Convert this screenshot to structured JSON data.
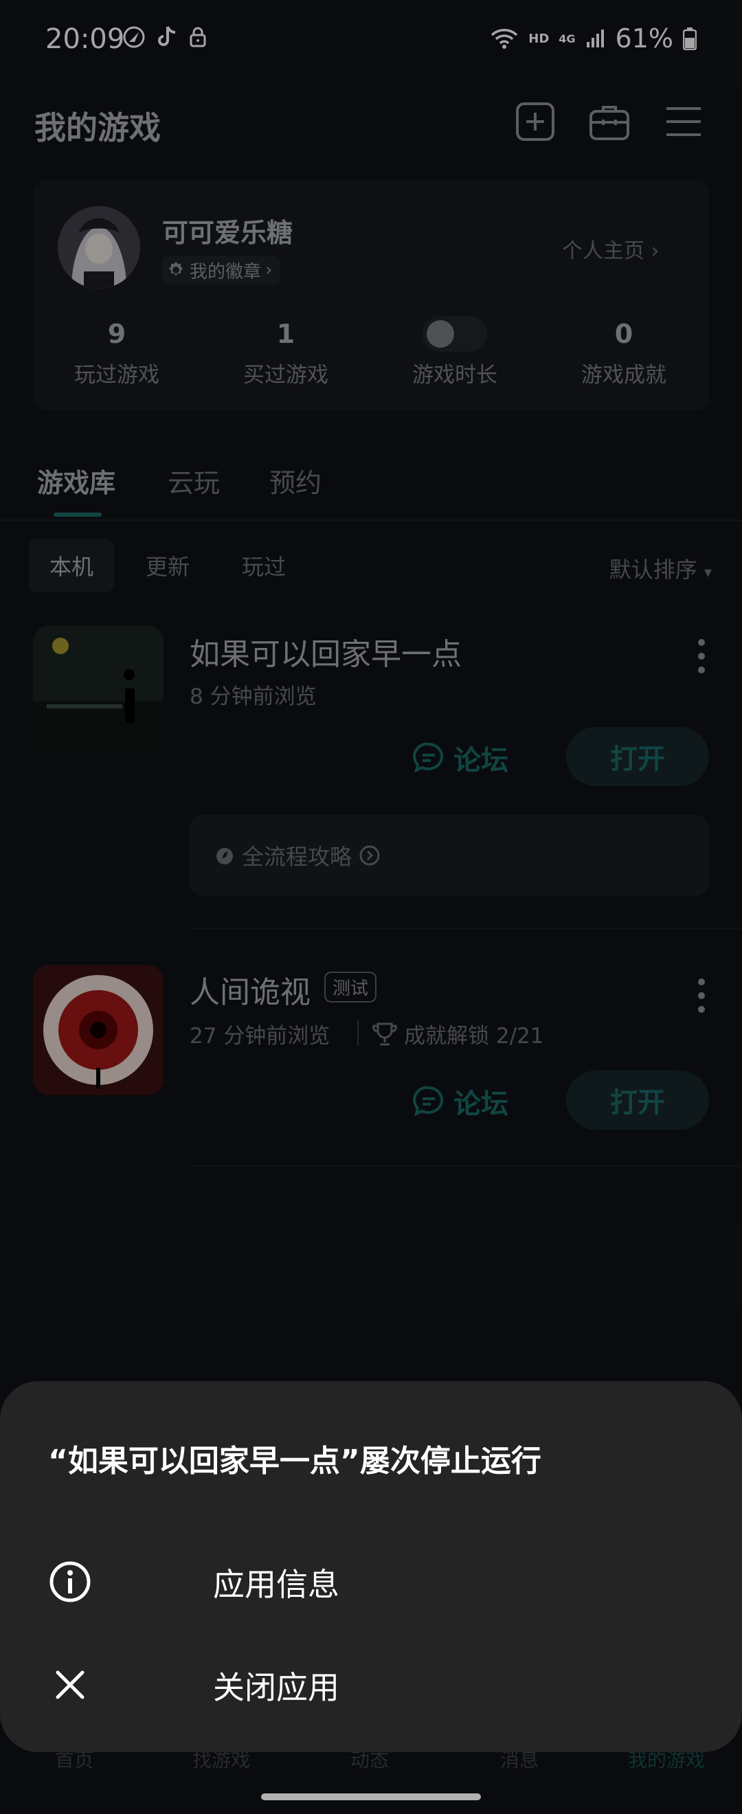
{
  "status_bar": {
    "time": "20:09",
    "hd": "HD",
    "network": "4G",
    "battery": "61%"
  },
  "header": {
    "title": "我的游戏",
    "icons": [
      "add-icon",
      "toolbox-icon",
      "menu-icon"
    ]
  },
  "profile": {
    "username": "可可爱乐糖",
    "badge_label": "我的徽章",
    "homepage_link": "个人主页",
    "stats": [
      {
        "value": "9",
        "label": "玩过游戏"
      },
      {
        "value": "1",
        "label": "买过游戏"
      },
      {
        "value": "",
        "label": "游戏时长"
      },
      {
        "value": "0",
        "label": "游戏成就"
      }
    ]
  },
  "tabs": [
    "游戏库",
    "云玩",
    "预约"
  ],
  "subtabs": [
    "本机",
    "更新",
    "玩过"
  ],
  "sort_label": "默认排序",
  "games": [
    {
      "title": "如果可以回家早一点",
      "subtitle": "8 分钟前浏览",
      "forum": "论坛",
      "open": "打开",
      "guide": "全流程攻略"
    },
    {
      "title": "人间诡视",
      "badge": "测试",
      "subtitle": "27 分钟前浏览",
      "achievement": "成就解锁 2/21",
      "forum": "论坛",
      "open": "打开"
    }
  ],
  "bottom_nav": [
    "首页",
    "找游戏",
    "动态",
    "消息",
    "我的游戏"
  ],
  "dialog": {
    "title": "“如果可以回家早一点”屡次停止运行",
    "items": [
      {
        "icon": "info-icon",
        "label": "应用信息"
      },
      {
        "icon": "close-icon",
        "label": "关闭应用"
      }
    ]
  },
  "colors": {
    "accent": "#1a6a66",
    "sheet": "#242424",
    "background": "#101216"
  }
}
